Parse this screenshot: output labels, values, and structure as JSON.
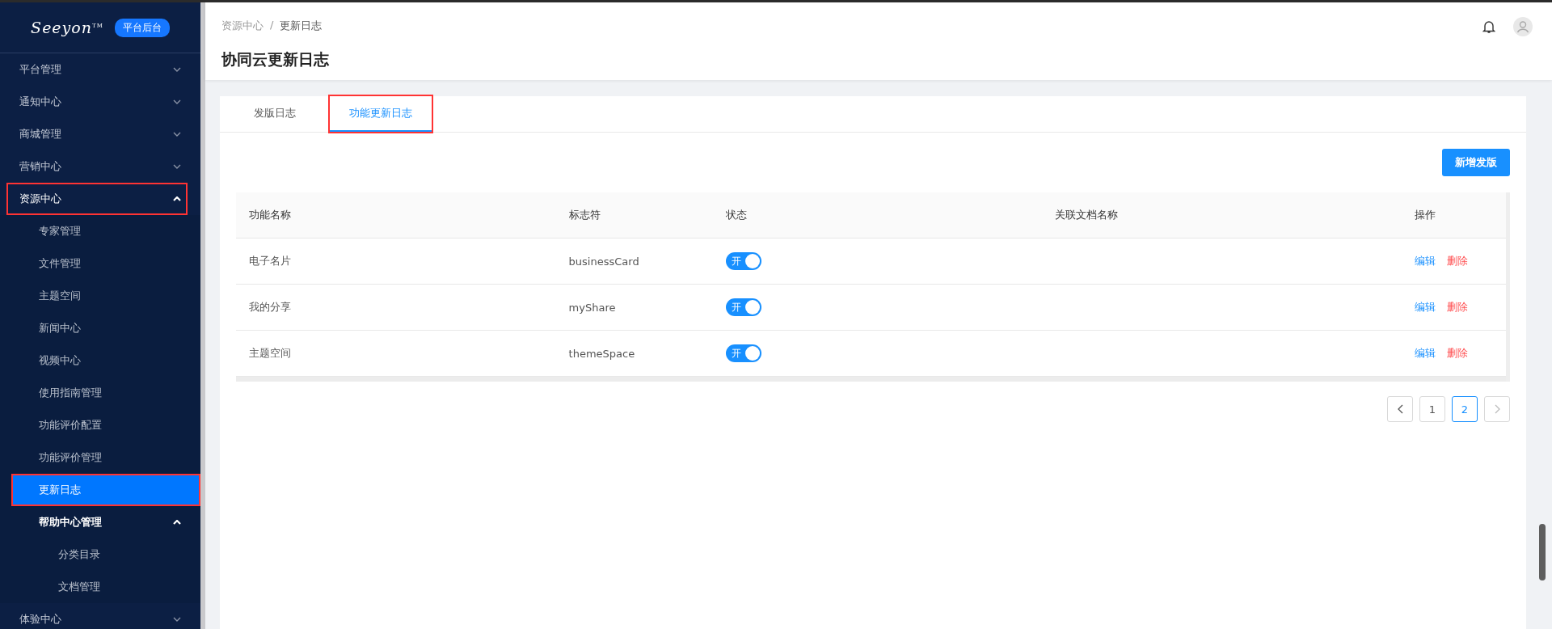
{
  "sidebar": {
    "logo": "Seeyon",
    "logo_mark": "TM",
    "badge": "平台后台",
    "items": [
      {
        "label": "平台管理",
        "expanded": false,
        "selected": false,
        "highlighted": false
      },
      {
        "label": "通知中心",
        "expanded": false,
        "selected": false,
        "highlighted": false
      },
      {
        "label": "商城管理",
        "expanded": false,
        "selected": false,
        "highlighted": false
      },
      {
        "label": "营销中心",
        "expanded": false,
        "selected": false,
        "highlighted": false
      },
      {
        "label": "资源中心",
        "expanded": true,
        "selected": false,
        "highlighted": true,
        "children": [
          {
            "label": "专家管理",
            "selected": false,
            "highlighted": false
          },
          {
            "label": "文件管理",
            "selected": false,
            "highlighted": false
          },
          {
            "label": "主题空间",
            "selected": false,
            "highlighted": false
          },
          {
            "label": "新闻中心",
            "selected": false,
            "highlighted": false
          },
          {
            "label": "视频中心",
            "selected": false,
            "highlighted": false
          },
          {
            "label": "使用指南管理",
            "selected": false,
            "highlighted": false
          },
          {
            "label": "功能评价配置",
            "selected": false,
            "highlighted": false
          },
          {
            "label": "功能评价管理",
            "selected": false,
            "highlighted": false
          },
          {
            "label": "更新日志",
            "selected": true,
            "highlighted": true
          },
          {
            "label": "帮助中心管理",
            "expanded": true,
            "selected": false,
            "highlighted": false,
            "children": [
              {
                "label": "分类目录",
                "selected": false,
                "highlighted": false
              },
              {
                "label": "文档管理",
                "selected": false,
                "highlighted": false
              }
            ]
          }
        ]
      },
      {
        "label": "体验中心",
        "expanded": false,
        "selected": false,
        "highlighted": false
      }
    ]
  },
  "breadcrumb": [
    "资源中心",
    "更新日志"
  ],
  "breadcrumb_separator": "/",
  "page_title": "协同云更新日志",
  "tabs": [
    {
      "label": "发版日志",
      "selected": false,
      "highlighted": false
    },
    {
      "label": "功能更新日志",
      "selected": true,
      "highlighted": true
    }
  ],
  "add_button": "新增发版",
  "table": {
    "columns": [
      "功能名称",
      "标志符",
      "状态",
      "关联文档名称",
      "操作"
    ],
    "rows": [
      {
        "name": "电子名片",
        "key": "businessCard",
        "status_label": "开",
        "on": true,
        "actions": [
          "编辑",
          "删除"
        ]
      },
      {
        "name": "我的分享",
        "key": "myShare",
        "status_label": "开",
        "on": true,
        "actions": [
          "编辑",
          "删除"
        ]
      },
      {
        "name": "主题空间",
        "key": "themeSpace",
        "status_label": "开",
        "on": true,
        "actions": [
          "编辑",
          "删除"
        ]
      }
    ]
  },
  "pagination": {
    "pages": [
      {
        "label": "1",
        "selected": false
      },
      {
        "label": "2",
        "selected": true
      }
    ]
  }
}
